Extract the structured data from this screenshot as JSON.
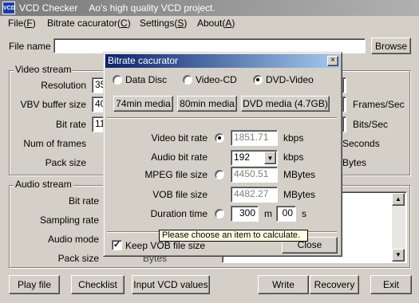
{
  "app": {
    "icon_text": "VCD",
    "title": "VCD Checker",
    "subtitle": "Ao's high quality VCD project."
  },
  "menu": [
    {
      "label": "File(",
      "key": "F",
      "end": ")"
    },
    {
      "label": "Bitrate cacurator(",
      "key": "C",
      "end": ")"
    },
    {
      "label": "Settings(",
      "key": "S",
      "end": ")"
    },
    {
      "label": "About(",
      "key": "A",
      "end": ")"
    }
  ],
  "file": {
    "label": "File name",
    "value": "",
    "browse": "Browse"
  },
  "video_stream": {
    "title": "Video stream",
    "resolution_label": "Resolution",
    "resolution_value": "35",
    "vbv_label": "VBV buffer size",
    "vbv_value": "40",
    "bitrate_label": "Bit rate",
    "bitrate_value": "11",
    "frames_label": "Num of frames",
    "pack_label": "Pack size",
    "fps_unit": "Frames/Sec",
    "bps_unit": "Bits/Sec",
    "seconds_unit": "Seconds",
    "bytes_unit": "Bytes"
  },
  "audio_stream": {
    "title": "Audio stream",
    "bitrate_label": "Bit rate",
    "sampling_label": "Sampling rate",
    "mode_label": "Audio mode",
    "pack_label": "Pack size",
    "pack_unit": "Bytes"
  },
  "buttons": {
    "play": "Play file",
    "checklist": "Checklist",
    "input_vcd": "Input VCD values",
    "write": "Write",
    "recovery": "Recovery",
    "exit": "Exit"
  },
  "dialog": {
    "title": "Bitrate cacurator",
    "close_x": "×",
    "disc_options": [
      "Data Disc",
      "Video-CD",
      "DVD-Video"
    ],
    "disc_selected": "DVD-Video",
    "media_buttons": [
      "74min media",
      "80min media",
      "DVD media (4.7GB)"
    ],
    "rows": {
      "video_bitrate": {
        "label": "Video bit rate",
        "value": "1851.71",
        "unit": "kbps"
      },
      "audio_bitrate": {
        "label": "Audio bit rate",
        "value": "192",
        "unit": "kbps"
      },
      "mpeg_size": {
        "label": "MPEG file size",
        "value": "4450.51",
        "unit": "MBytes"
      },
      "vob_size": {
        "label": "VOB file size",
        "value": "4482.27",
        "unit": "MBytes"
      },
      "duration": {
        "label": "Duration time",
        "minutes": "300",
        "m_unit": "m",
        "seconds": "00",
        "s_unit": "s"
      }
    },
    "calc_selected": "video_bitrate",
    "keep_vob_label": "Keep VOB file size",
    "keep_vob_checked": true,
    "check_mark": "✓",
    "close_button": "Close",
    "tooltip": "Please choose an item to calculate."
  }
}
